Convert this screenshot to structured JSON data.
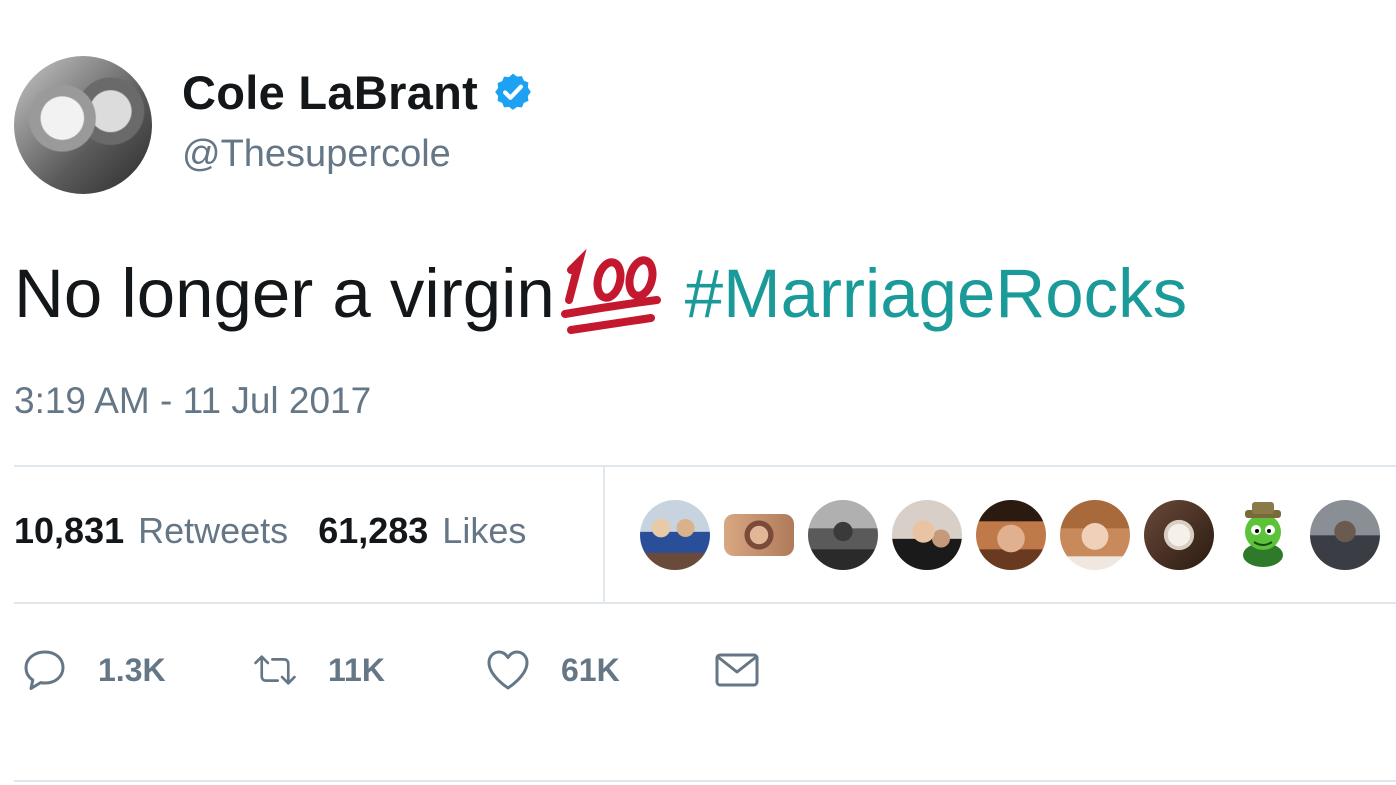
{
  "user": {
    "name": "Cole LaBrant",
    "handle": "@Thesupercole",
    "verified": true
  },
  "tweet": {
    "text": "No longer a virgin",
    "emoji": "hundred-points-emoji",
    "hashtag": "#MarriageRocks",
    "timestamp": "3:19 AM - 11 Jul 2017"
  },
  "stats": {
    "retweets_count": "10,831",
    "retweets_label": "Retweets",
    "likes_count": "61,283",
    "likes_label": "Likes"
  },
  "actions": {
    "reply_count": "1.3K",
    "retweet_count": "11K",
    "like_count": "61K"
  },
  "colors": {
    "hashtag": "#1b9a9a",
    "secondary": "#657786",
    "verified": "#1da1f2",
    "divider": "#e1e8ed"
  }
}
